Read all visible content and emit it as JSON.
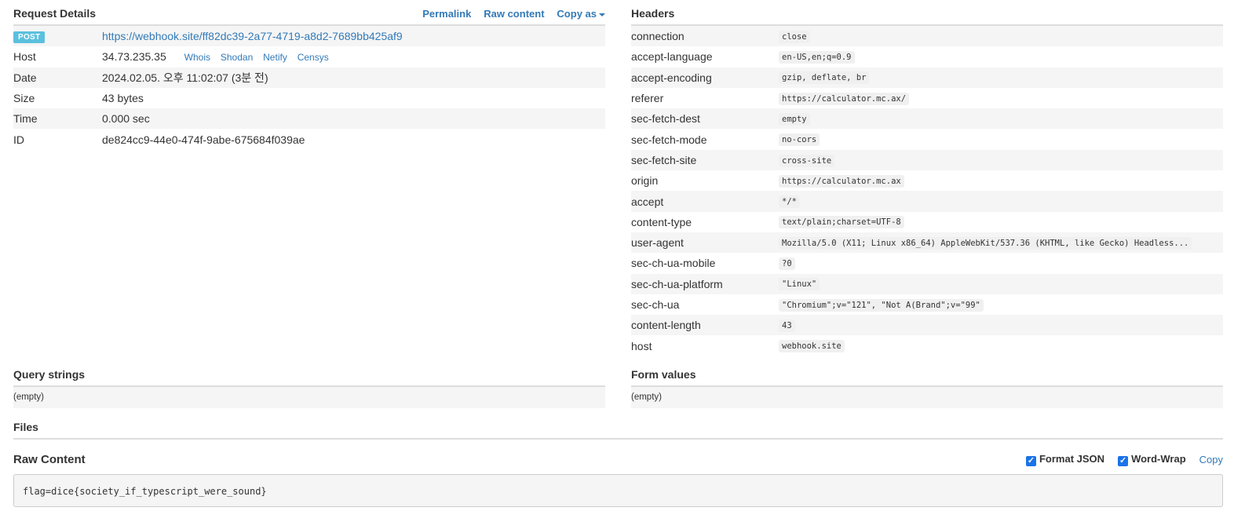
{
  "request_details": {
    "title": "Request Details",
    "links": {
      "permalink": "Permalink",
      "raw_content": "Raw content",
      "copy_as": "Copy as"
    },
    "method": "POST",
    "url": "https://webhook.site/ff82dc39-2a77-4719-a8d2-7689bb425af9",
    "host_label": "Host",
    "host_value": "34.73.235.35",
    "host_links": [
      "Whois",
      "Shodan",
      "Netify",
      "Censys"
    ],
    "date_label": "Date",
    "date_value": "2024.02.05. 오후 11:02:07 (3분 전)",
    "size_label": "Size",
    "size_value": "43 bytes",
    "time_label": "Time",
    "time_value": "0.000 sec",
    "id_label": "ID",
    "id_value": "de824cc9-44e0-474f-9abe-675684f039ae"
  },
  "headers": {
    "title": "Headers",
    "rows": [
      {
        "key": "connection",
        "value": "close"
      },
      {
        "key": "accept-language",
        "value": "en-US,en;q=0.9"
      },
      {
        "key": "accept-encoding",
        "value": "gzip, deflate, br"
      },
      {
        "key": "referer",
        "value": "https://calculator.mc.ax/"
      },
      {
        "key": "sec-fetch-dest",
        "value": "empty"
      },
      {
        "key": "sec-fetch-mode",
        "value": "no-cors"
      },
      {
        "key": "sec-fetch-site",
        "value": "cross-site"
      },
      {
        "key": "origin",
        "value": "https://calculator.mc.ax"
      },
      {
        "key": "accept",
        "value": "*/*"
      },
      {
        "key": "content-type",
        "value": "text/plain;charset=UTF-8"
      },
      {
        "key": "user-agent",
        "value": "Mozilla/5.0 (X11; Linux x86_64) AppleWebKit/537.36 (KHTML, like Gecko) Headless..."
      },
      {
        "key": "sec-ch-ua-mobile",
        "value": "?0"
      },
      {
        "key": "sec-ch-ua-platform",
        "value": "\"Linux\""
      },
      {
        "key": "sec-ch-ua",
        "value": "\"Chromium\";v=\"121\", \"Not A(Brand\";v=\"99\""
      },
      {
        "key": "content-length",
        "value": "43"
      },
      {
        "key": "host",
        "value": "webhook.site"
      }
    ]
  },
  "query_strings": {
    "title": "Query strings",
    "value": "(empty)"
  },
  "form_values": {
    "title": "Form values",
    "value": "(empty)"
  },
  "files": {
    "title": "Files"
  },
  "raw_content": {
    "title": "Raw Content",
    "format_json_label": "Format JSON",
    "format_json_checked": true,
    "word_wrap_label": "Word-Wrap",
    "word_wrap_checked": true,
    "copy_label": "Copy",
    "body": "flag=dice{society_if_typescript_were_sound}"
  },
  "colors": {
    "link": "#337ab7",
    "badge": "#5bc0de",
    "stripe": "#f5f5f5",
    "checkbox": "#1a73e8"
  }
}
